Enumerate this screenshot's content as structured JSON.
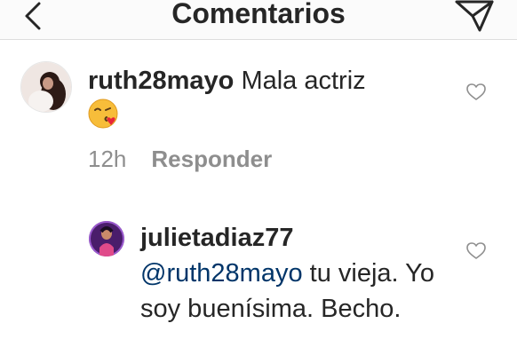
{
  "header": {
    "title": "Comentarios",
    "back_icon": "chevron-left-icon",
    "send_icon": "paper-plane-icon"
  },
  "comments": [
    {
      "username": "ruth28mayo",
      "text": "Mala actriz",
      "emoji_icon": "face-blowing-kiss-emoji",
      "time": "12h",
      "reply_label": "Responder"
    },
    {
      "username": "julietadiaz77",
      "mention": "@ruth28mayo",
      "text": "tu vieja. Yo soy buenísima. Becho."
    }
  ],
  "colors": {
    "mention": "#003569",
    "meta": "#8e8e8e",
    "text": "#262626"
  }
}
